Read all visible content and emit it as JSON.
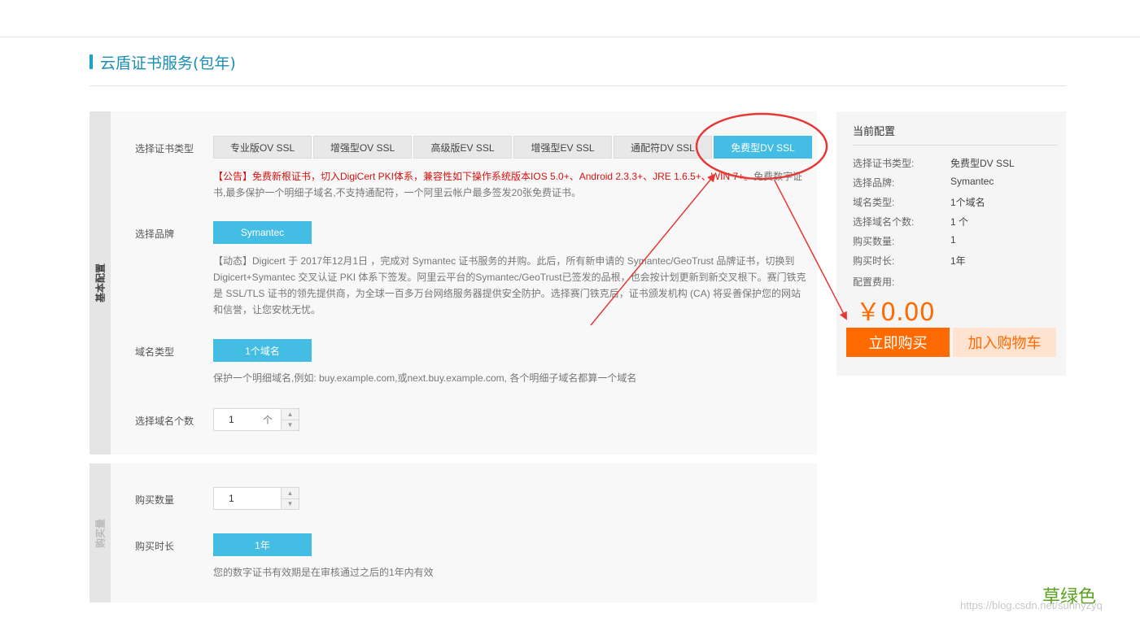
{
  "page": {
    "title": "云盾证书服务(包年)"
  },
  "basic_config": {
    "side_label": "基本配置",
    "cert_type": {
      "label": "选择证书类型",
      "tabs": [
        "专业版OV SSL",
        "增强型OV SSL",
        "高级版EV SSL",
        "增强型EV SSL",
        "通配符DV SSL",
        "免费型DV SSL"
      ],
      "active_index": 5
    },
    "notice_red": "【公告】免费新根证书，切入DigiCert PKI体系，兼容性如下操作系统版本IOS 5.0+、Android 2.3.3+、JRE 1.6.5+、WIN 7+。",
    "notice_gray": "免费数字证书,最多保护一个明细子域名,不支持通配符，一个阿里云帐户最多签发20张免费证书。",
    "brand": {
      "label": "选择品牌",
      "value": "Symantec",
      "info": "【动态】Digicert 于 2017年12月1日 ，完成对 Symantec 证书服务的并购。此后，所有新申请的 Symantec/GeoTrust 品牌证书，切换到 Digicert+Symantec 交叉认证 PKI 体系下签发。阿里云平台的Symantec/GeoTrust已签发的品根，也会按计划更新到新交叉根下。赛门铁克是 SSL/TLS 证书的领先提供商，为全球一百多万台网络服务器提供安全防护。选择赛门铁克后，证书颁发机构 (CA) 将妥善保护您的网站和信誉，让您安枕无忧。"
    },
    "domain_type": {
      "label": "域名类型",
      "value": "1个域名",
      "info": "保护一个明细域名,例如: buy.example.com,或next.buy.example.com, 各个明细子域名都算一个域名"
    },
    "domain_count": {
      "label": "选择域名个数",
      "value": "1",
      "unit": "个"
    }
  },
  "purchase": {
    "side_label": "购买量",
    "quantity": {
      "label": "购买数量",
      "value": "1"
    },
    "duration": {
      "label": "购买时长",
      "value": "1年",
      "info": "您的数字证书有效期是在审核通过之后的1年内有效"
    }
  },
  "summary": {
    "title": "当前配置",
    "rows": [
      {
        "key": "选择证书类型:",
        "value": "免费型DV SSL"
      },
      {
        "key": "选择品牌:",
        "value": "Symantec"
      },
      {
        "key": "域名类型:",
        "value": "1个域名"
      },
      {
        "key": "选择域名个数:",
        "value": "1 个"
      },
      {
        "key": "购买数量:",
        "value": "1"
      },
      {
        "key": "购买时长:",
        "value": "1年"
      }
    ],
    "fee_label": "配置费用:",
    "price": "￥0.00",
    "buy_label": "立即购买",
    "cart_label": "加入购物车"
  },
  "annotation": {
    "green_text": "草绿色",
    "watermark": "https://blog.csdn.net/sunnyzyq",
    "color_annotation": "#e53935"
  },
  "colors": {
    "accent": "#44bde4",
    "buy": "#ff6a00",
    "notice_red": "#d9120f",
    "green_text": "#5aa21f"
  }
}
